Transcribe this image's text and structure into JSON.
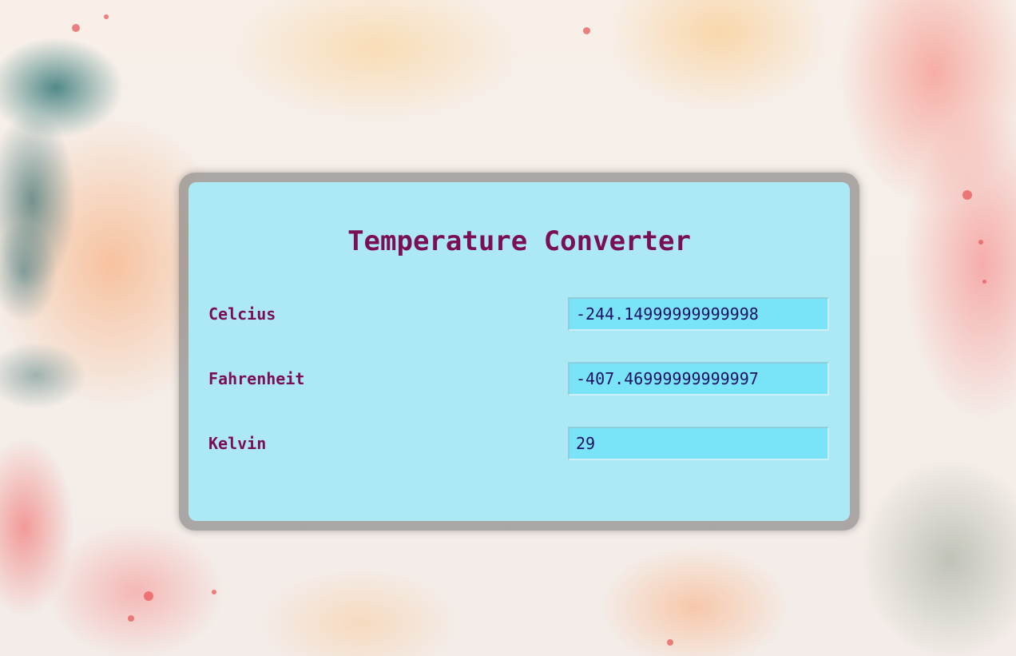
{
  "app": {
    "title": "Temperature Converter"
  },
  "fields": [
    {
      "label": "Celcius",
      "value": "-244.14999999999998"
    },
    {
      "label": "Fahrenheit",
      "value": "-407.46999999999997"
    },
    {
      "label": "Kelvin",
      "value": "29"
    }
  ],
  "colors": {
    "title_text": "#7b0f55",
    "label_text": "#7b0f55",
    "input_text": "#1a1166",
    "panel_background": "#ade9f4",
    "input_background": "#79e3f7",
    "frame_border": "#8c8c8c"
  }
}
